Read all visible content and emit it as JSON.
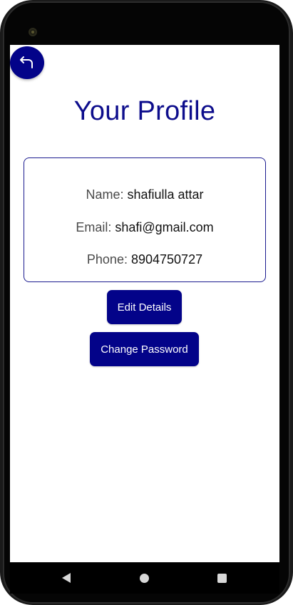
{
  "header": {
    "title": "Your Profile",
    "back_icon": "back-arrow-icon"
  },
  "profile": {
    "name_label": "Name:",
    "name_value": "shafiulla attar",
    "email_label": "Email:",
    "email_value": "shafi@gmail.com",
    "phone_label": "Phone:",
    "phone_value": "8904750727"
  },
  "actions": {
    "edit_label": "Edit Details",
    "password_label": "Change Password"
  },
  "colors": {
    "accent": "#030389",
    "title": "#0d0d8c",
    "card_border": "#1a1a8f"
  },
  "nav": {
    "back_icon": "triangle-back-icon",
    "home_icon": "circle-home-icon",
    "recent_icon": "square-recents-icon"
  }
}
